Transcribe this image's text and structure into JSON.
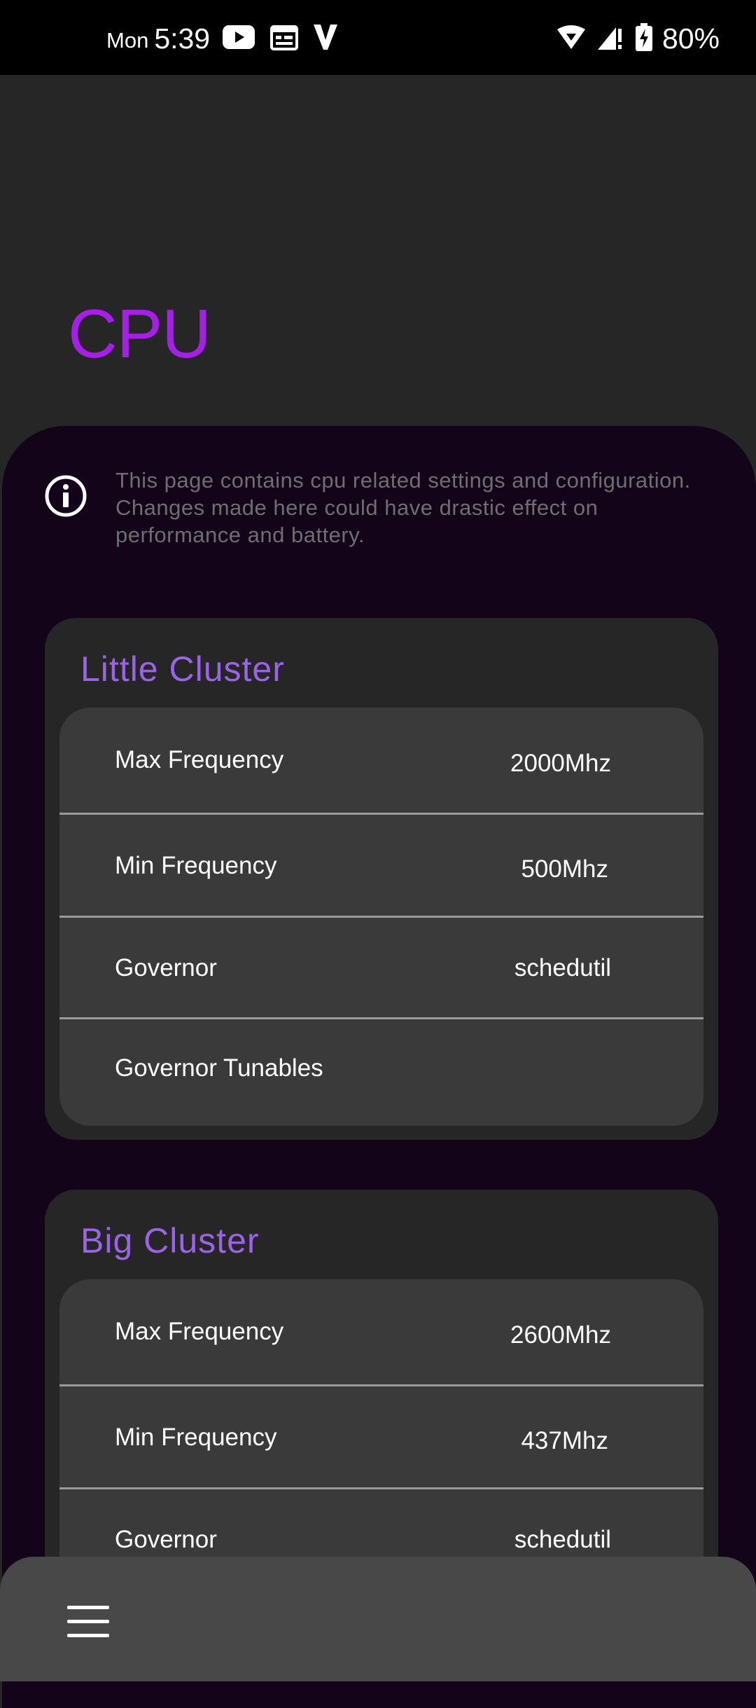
{
  "status_bar": {
    "day": "Mon",
    "time": "5:39",
    "battery": "80%",
    "left_icons": [
      "youtube-icon",
      "calendar-icon",
      "vpn-icon"
    ],
    "right_icons": [
      "wifi-icon",
      "signal-icon",
      "battery-charging-icon"
    ]
  },
  "page": {
    "title": "CPU",
    "info_text": "This page contains cpu related settings and configuration. Changes made here could have drastic effect on performance and battery.",
    "info_icon": "info-icon"
  },
  "clusters": [
    {
      "title": "Little Cluster",
      "rows": [
        {
          "label": "Max Frequency",
          "value": "2000Mhz"
        },
        {
          "label": "Min Frequency",
          "value": "500Mhz"
        },
        {
          "label": "Governor",
          "value": "schedutil"
        },
        {
          "label": "Governor Tunables",
          "value": ""
        }
      ]
    },
    {
      "title": "Big Cluster",
      "rows": [
        {
          "label": "Max Frequency",
          "value": "2600Mhz"
        },
        {
          "label": "Min Frequency",
          "value": "437Mhz"
        },
        {
          "label": "Governor",
          "value": "schedutil"
        }
      ]
    }
  ],
  "bottom_bar": {
    "menu_icon": "hamburger-menu-icon"
  },
  "colors": {
    "accent": "#a61ee8",
    "cluster_title": "#9b63e8",
    "panel_background": "#14041a",
    "card_background": "#262626",
    "row_background": "#3a3a3a"
  }
}
